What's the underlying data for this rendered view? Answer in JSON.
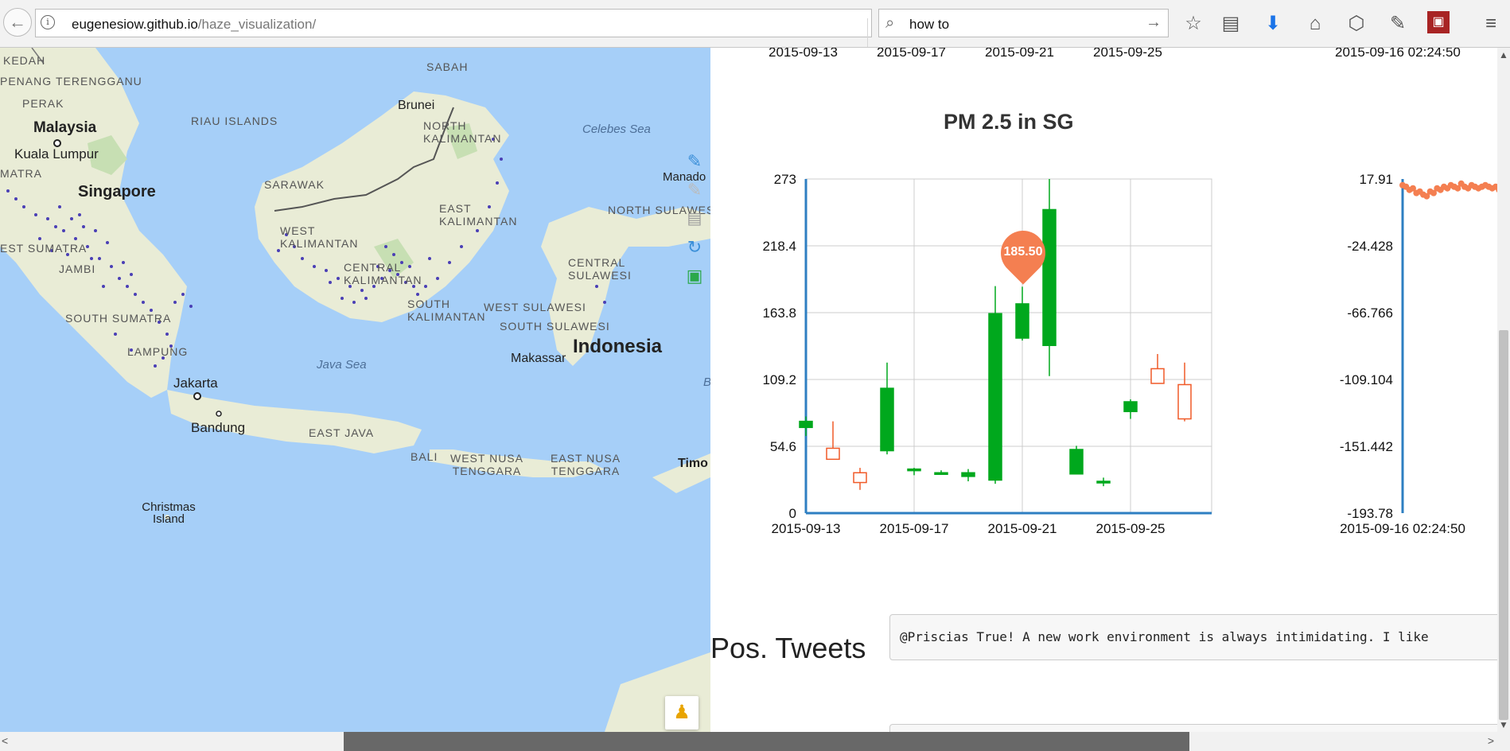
{
  "browser": {
    "url_host": "eugenesiow.github.io",
    "url_path": "/haze_visualization/",
    "search_text": "how to"
  },
  "map": {
    "labels": {
      "kedah": "KEDAH",
      "penang": "PENANG",
      "terengganu": "TERENGGANU",
      "perak": "PERAK",
      "malaysia": "Malaysia",
      "kuala_lumpur": "Kuala Lumpur",
      "riau_islands": "RIAU ISLANDS",
      "singapore": "Singapore",
      "matra": "MATRA",
      "est_sumatra": "EST SUMATRA",
      "jambi": "JAMBI",
      "south_sumatra": "SOUTH SUMATRA",
      "lampung": "LAMPUNG",
      "jakarta": "Jakarta",
      "bandung": "Bandung",
      "christmas_island": "Christmas Island",
      "sabah": "SABAH",
      "brunei": "Brunei",
      "north_kalimantan": "NORTH KALIMANTAN",
      "sarawak": "SARAWAK",
      "east_kalimantan": "EAST KALIMANTAN",
      "west_kalimantan": "WEST KALIMANTAN",
      "central_kalimantan": "CENTRAL KALIMANTAN",
      "south_kalimantan": "SOUTH KALIMANTAN",
      "celebes_sea": "Celebes Sea",
      "manado": "Manado",
      "north_sulawesi": "NORTH SULAWESI",
      "central_sulawesi": "CENTRAL SULAWESI",
      "west_sulawesi": "WEST SULAWESI",
      "south_sulawesi": "SOUTH SULAWESI",
      "indonesia": "Indonesia",
      "makassar": "Makassar",
      "java_sea": "Java Sea",
      "east_java": "EAST JAVA",
      "bali": "BALI",
      "west_nusa_tenggara": "WEST NUSA TENGGARA",
      "east_nusa_tenggara": "EAST NUSA TENGGARA",
      "timor": "Timo",
      "b": "B"
    },
    "zoom_in_label": "+"
  },
  "top_axis": {
    "ticks": [
      "2015-09-13",
      "2015-09-17",
      "2015-09-21",
      "2015-09-25"
    ],
    "right_tick": "2015-09-16 02:24:50"
  },
  "chart_data": [
    {
      "type": "candlestick",
      "title": "PM 2.5 in SG",
      "y_ticks": [
        "273",
        "218.4",
        "163.8",
        "109.2",
        "54.6",
        "0"
      ],
      "ylim": [
        0,
        273
      ],
      "x_ticks": [
        "2015-09-13",
        "2015-09-17",
        "2015-09-21",
        "2015-09-25"
      ],
      "xlim": [
        "2015-09-13",
        "2015-09-28"
      ],
      "grid": true,
      "tooltip": "185.50",
      "candles": [
        {
          "date": "2015-09-13",
          "open": 70,
          "close": 75,
          "high": 79,
          "low": 63
        },
        {
          "date": "2015-09-14",
          "open": 53,
          "close": 44,
          "high": 75,
          "low": 44
        },
        {
          "date": "2015-09-15",
          "open": 33,
          "close": 25,
          "high": 37,
          "low": 19
        },
        {
          "date": "2015-09-16",
          "open": 51,
          "close": 102,
          "high": 123,
          "low": 48
        },
        {
          "date": "2015-09-17",
          "open": 35,
          "close": 36,
          "high": 37,
          "low": 31
        },
        {
          "date": "2015-09-18",
          "open": 32,
          "close": 33,
          "high": 35,
          "low": 32
        },
        {
          "date": "2015-09-19",
          "open": 30,
          "close": 33,
          "high": 36,
          "low": 26
        },
        {
          "date": "2015-09-20",
          "open": 27,
          "close": 163,
          "high": 185.5,
          "low": 24
        },
        {
          "date": "2015-09-21",
          "open": 143,
          "close": 171,
          "high": 185,
          "low": 141
        },
        {
          "date": "2015-09-22",
          "open": 137,
          "close": 248,
          "high": 273,
          "low": 112
        },
        {
          "date": "2015-09-23",
          "open": 32,
          "close": 52,
          "high": 55,
          "low": 32
        },
        {
          "date": "2015-09-24",
          "open": 25,
          "close": 26,
          "high": 29,
          "low": 22
        },
        {
          "date": "2015-09-25",
          "open": 83,
          "close": 91,
          "high": 93,
          "low": 77
        },
        {
          "date": "2015-09-26",
          "open": 118,
          "close": 106,
          "high": 130,
          "low": 106
        },
        {
          "date": "2015-09-27",
          "open": 105,
          "close": 77,
          "high": 123,
          "low": 75
        }
      ],
      "colors": {
        "rising": "#00a81d",
        "falling": "#f05a28"
      }
    },
    {
      "type": "line",
      "y_ticks": [
        "17.91",
        "-24.428",
        "-66.766",
        "-109.104",
        "-151.442",
        "-193.78"
      ],
      "ylim": [
        -193.78,
        17.91
      ],
      "x_ticks": [
        "2015-09-16 02:24:50"
      ],
      "series": [
        {
          "values": [
            14,
            13,
            11,
            12,
            9,
            10,
            8,
            7,
            10,
            9,
            12,
            11,
            13,
            12,
            14,
            13,
            12,
            15,
            13,
            12,
            14,
            13,
            12,
            13,
            14,
            13,
            12,
            13,
            11,
            12
          ]
        }
      ],
      "colors": {
        "line": "#f47f51",
        "axis": "#2e7fc2"
      }
    }
  ],
  "tweets": {
    "title": "Pos. Tweets",
    "first": "@Priscias True! A new work environment is always intimidating. I like"
  }
}
